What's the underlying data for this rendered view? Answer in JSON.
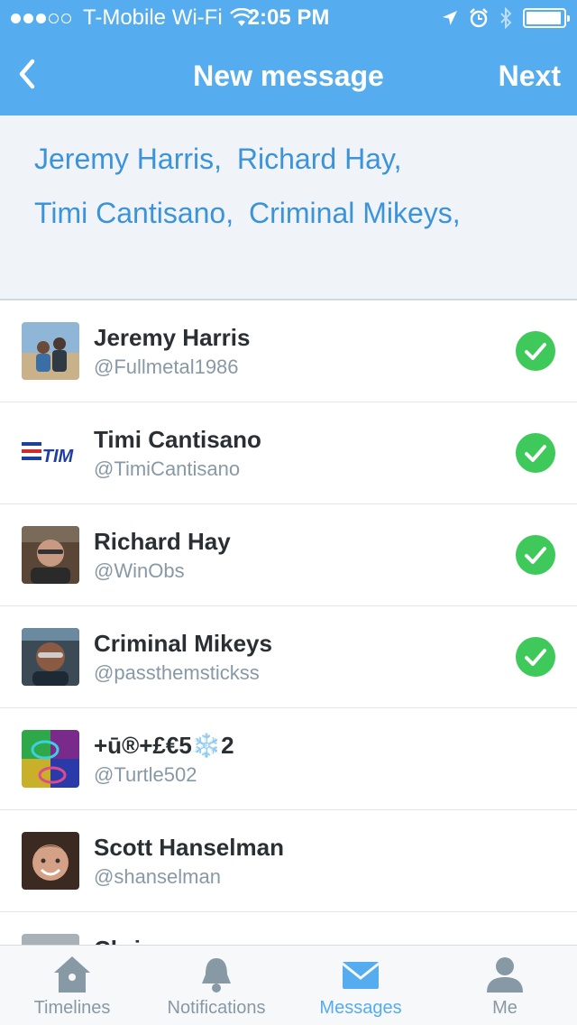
{
  "status_bar": {
    "carrier": "T-Mobile Wi-Fi",
    "time": "2:05 PM",
    "signal_bars_filled": 3,
    "signal_bars_total": 5,
    "battery_level": 0.95
  },
  "nav": {
    "back_icon": "chevron-left-icon",
    "title": "New message",
    "next_label": "Next"
  },
  "recipients": {
    "line1": [
      "Jeremy Harris,",
      "Richard Hay,"
    ],
    "line2": [
      "Timi Cantisano,",
      "Criminal Mikeys,"
    ]
  },
  "contacts": [
    {
      "name": "Jeremy Harris",
      "handle": "@Fullmetal1986",
      "selected": true
    },
    {
      "name": "Timi Cantisano",
      "handle": "@TimiCantisano",
      "selected": true,
      "avatar_text": "TIM"
    },
    {
      "name": "Richard Hay",
      "handle": "@WinObs",
      "selected": true
    },
    {
      "name": "Criminal Mikeys",
      "handle": "@passthemstickss",
      "selected": true
    },
    {
      "name": "+ū®+£€5❄️2",
      "handle": "@Turtle502",
      "selected": false
    },
    {
      "name": "Scott Hanselman",
      "handle": "@shanselman",
      "selected": false
    },
    {
      "name": "Chris",
      "handle": "",
      "selected": false
    }
  ],
  "tabs": [
    {
      "label": "Timelines",
      "icon": "home-icon",
      "active": false
    },
    {
      "label": "Notifications",
      "icon": "bell-icon",
      "active": false
    },
    {
      "label": "Messages",
      "icon": "envelope-icon",
      "active": true
    },
    {
      "label": "Me",
      "icon": "person-icon",
      "active": false
    }
  ],
  "colors": {
    "header": "#55acee",
    "recipient_text": "#3b94d9",
    "check_green": "#3ec95a",
    "tab_active": "#55acee",
    "tab_inactive": "#8899a6"
  }
}
